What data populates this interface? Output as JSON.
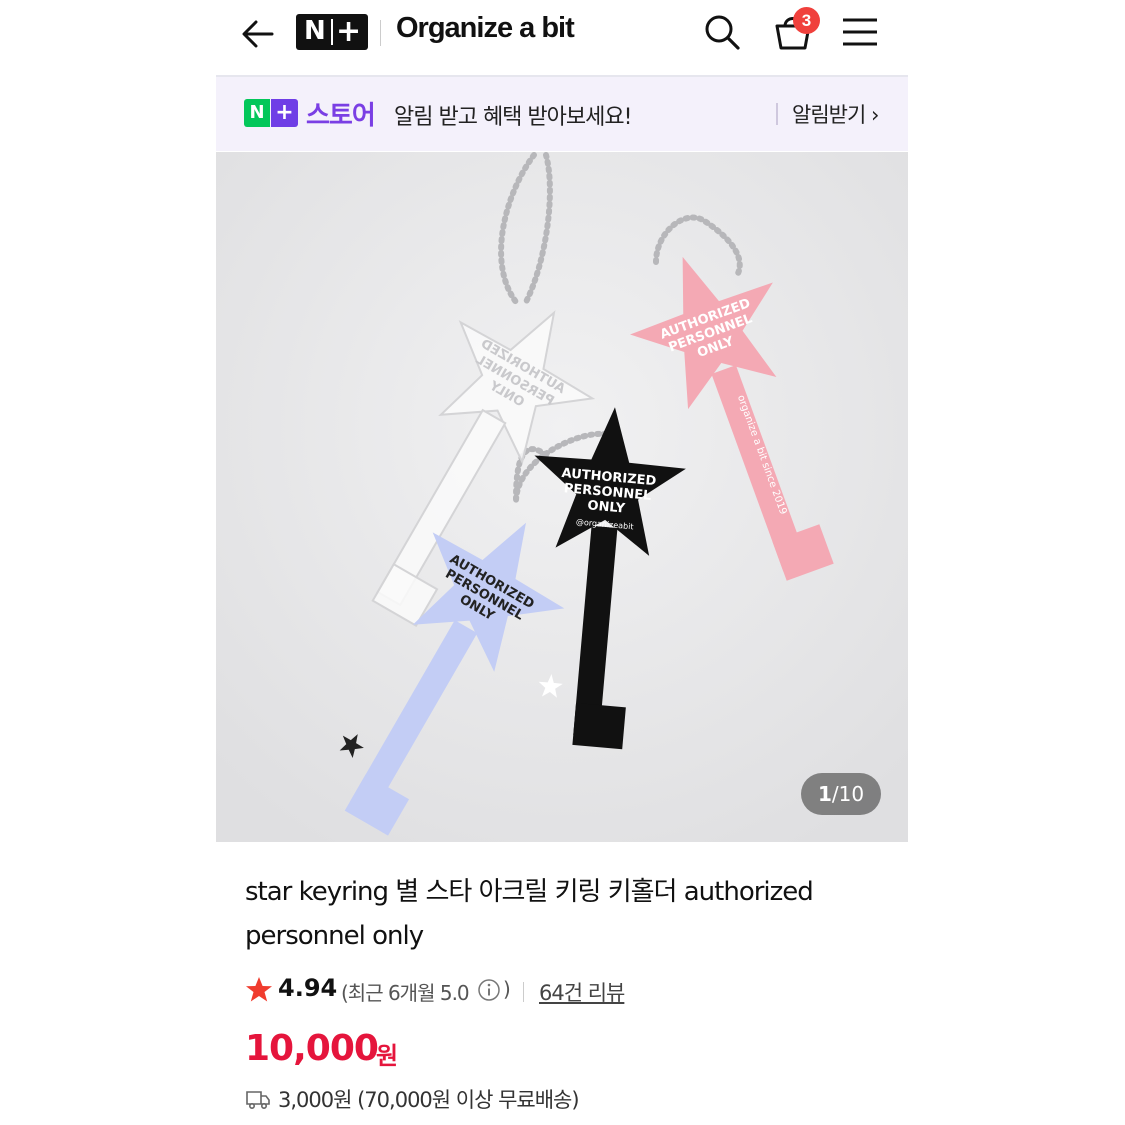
{
  "header": {
    "back_icon": "arrow-left-icon",
    "logo_n": "N",
    "logo_plus": "+",
    "store_name": "Organize a bit",
    "search_icon": "search-icon",
    "cart_icon": "shopping-bag-icon",
    "cart_count": "3",
    "menu_icon": "hamburger-menu-icon"
  },
  "notification": {
    "badge_n": "N",
    "badge_plus": "+",
    "store_label": "스토어",
    "message": "알림 받고 혜택 받아보세요!",
    "action": "알림받기 ›"
  },
  "gallery": {
    "current": "1",
    "separator": "/",
    "total": "10",
    "keys": [
      {
        "color": "#f4f4f4",
        "text": [
          "AUTHORIZED",
          "PERSONNEL",
          "ONLY"
        ]
      },
      {
        "color": "#f4a9b4",
        "text": [
          "AUTHORIZED",
          "PERSONNEL",
          "ONLY"
        ]
      },
      {
        "color": "#111111",
        "text": [
          "AUTHORIZED",
          "PERSONNEL",
          "ONLY"
        ]
      },
      {
        "color": "#c3cdf5",
        "text": [
          "AUTHORIZED",
          "PERSONNEL",
          "ONLY"
        ]
      }
    ],
    "engraving_small": "@organizeabit",
    "engraving_side": "organize a bit since 2019"
  },
  "product": {
    "title": "star keyring 별 스타 아크릴 키링 키홀더 authorized personnel only",
    "rating": "4.94",
    "recent_rating": "(최근 6개월 5.0",
    "recent_close": ")",
    "reviews": "64건 리뷰",
    "price": "10,000",
    "price_unit": "원",
    "shipping": "3,000원 (70,000원 이상 무료배송)"
  },
  "colors": {
    "accent_purple": "#7a3fe4",
    "naver_green": "#03c75a",
    "price_red": "#e5153c",
    "badge_red": "#f0403c",
    "star_red": "#f03c2e"
  }
}
